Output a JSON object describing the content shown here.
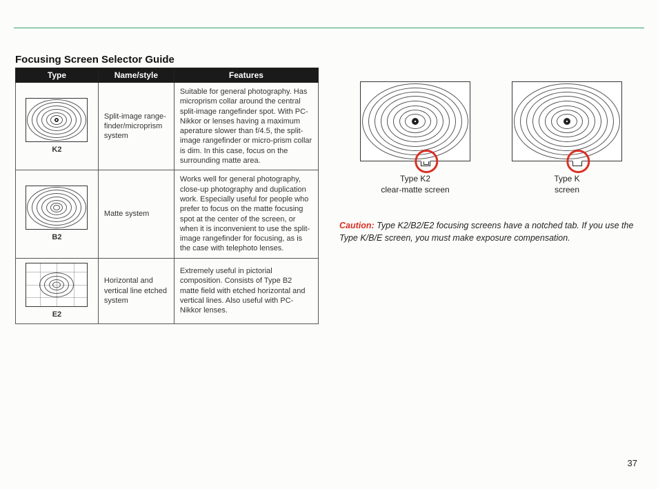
{
  "page": {
    "title": "Focusing Screen Selector Guide",
    "number": "37"
  },
  "table": {
    "headers": {
      "type": "Type",
      "name": "Name/style",
      "features": "Features"
    },
    "rows": [
      {
        "type_label": "K2",
        "name": "Split-image range-finder/microprism system",
        "features": "Suitable for general photography. Has microprism collar around the central split-image rangefinder spot. With PC-Nikkor or lenses having a maximum aperature slower than f/4.5, the split-image rangefinder or micro-prism collar is dim. In this case, focus on the surrounding matte area."
      },
      {
        "type_label": "B2",
        "name": "Matte system",
        "features": "Works well for general photography, close-up photography and duplication work. Especially useful for people who prefer to focus on the matte focusing spot at the center of the screen, or when it is inconvenient to use the split-image rangefinder for focusing, as is the case with telephoto lenses."
      },
      {
        "type_label": "E2",
        "name": "Horizontal and vertical line etched system",
        "features": "Extremely useful in pictorial composition. Consists of Type B2 matte field with etched horizontal and vertical lines. Also useful with PC-Nikkor lenses."
      }
    ]
  },
  "diagrams": {
    "left": {
      "line1": "Type K2",
      "line2": "clear-matte screen"
    },
    "right": {
      "line1": "Type K",
      "line2": "screen"
    }
  },
  "caution": {
    "label": "Caution:",
    "text": "Type K2/B2/E2 focusing screens have a notched tab. If you use the Type K/B/E screen, you must make exposure compensation."
  }
}
